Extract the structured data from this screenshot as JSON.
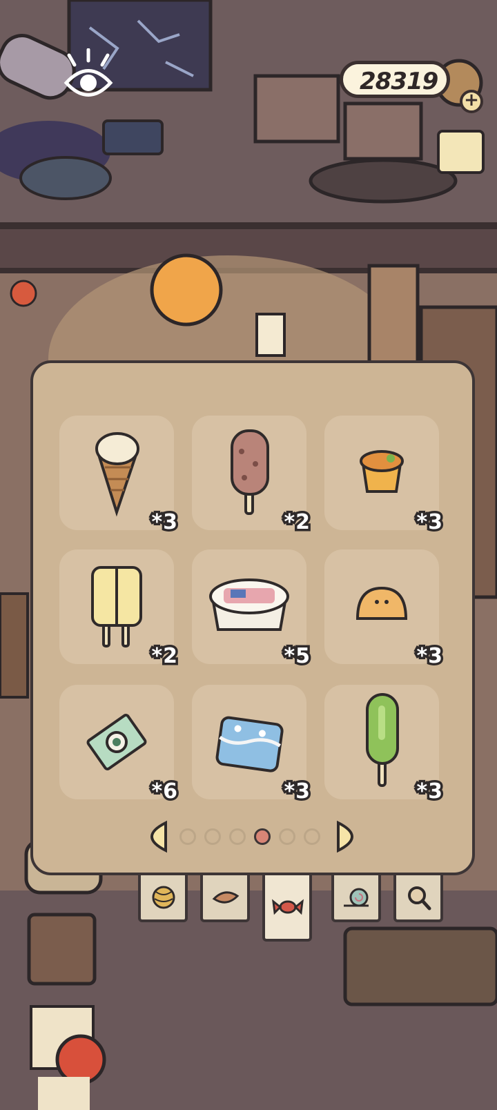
{
  "currency": {
    "amount": "28319",
    "add_label": "+"
  },
  "inventory": {
    "items": [
      {
        "name": "ice-cream-cone",
        "count": "*3"
      },
      {
        "name": "chocolate-popsicle",
        "count": "*2"
      },
      {
        "name": "fruit-cup",
        "count": "*3"
      },
      {
        "name": "twin-popsicle",
        "count": "*2"
      },
      {
        "name": "ice-cream-tub",
        "count": "*5"
      },
      {
        "name": "bun",
        "count": "*3"
      },
      {
        "name": "candy-packet",
        "count": "*6"
      },
      {
        "name": "blue-ice-cream-box",
        "count": "*3"
      },
      {
        "name": "green-popsicle",
        "count": "*3"
      }
    ],
    "pagination": {
      "total_pages": 6,
      "current_page": 4
    }
  },
  "tabs": [
    {
      "name": "yarn-icon",
      "active": false
    },
    {
      "name": "leaf-icon",
      "active": false
    },
    {
      "name": "candy-icon",
      "active": true
    },
    {
      "name": "snail-icon",
      "active": false
    },
    {
      "name": "magnifier-icon",
      "active": false
    }
  ],
  "colors": {
    "panel": "#cdb595",
    "slot": "#d7c1a4",
    "outline": "#3d3536",
    "active_dot": "#d88576"
  }
}
